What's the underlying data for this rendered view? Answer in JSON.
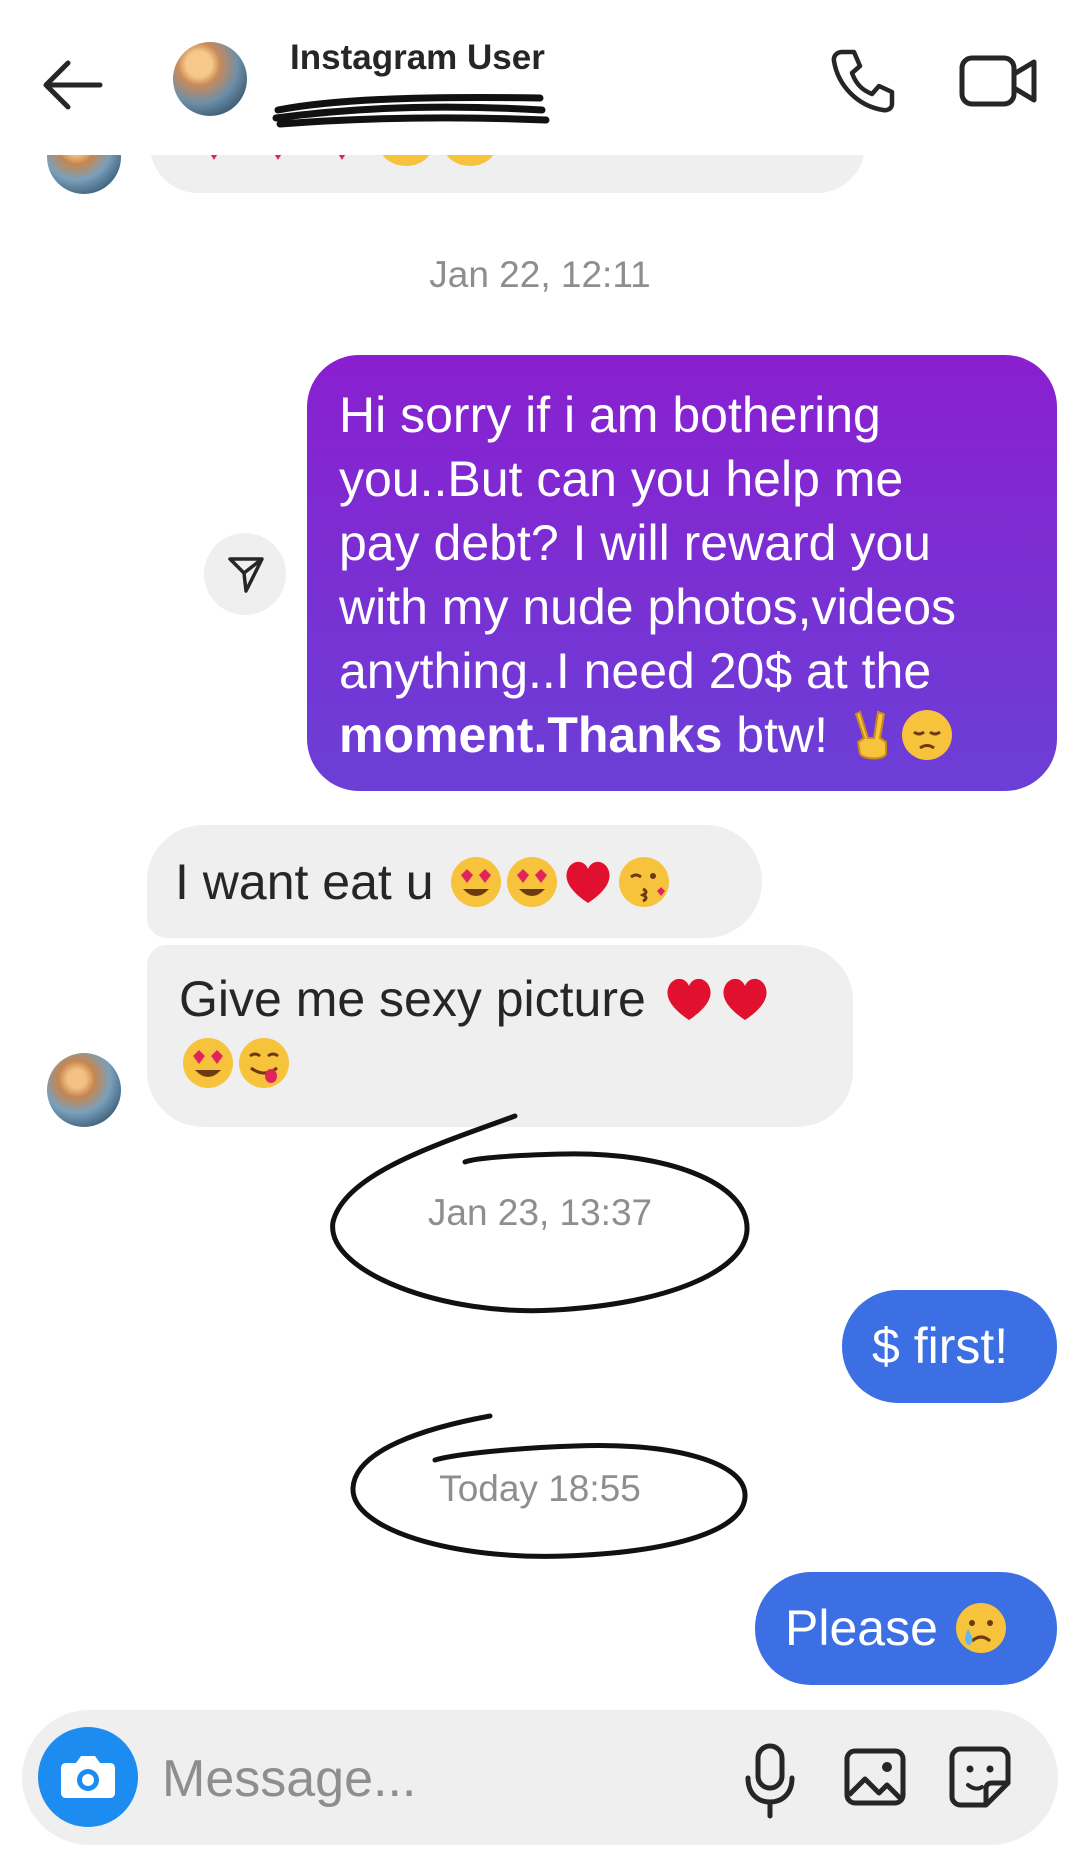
{
  "header": {
    "contact_name": "Instagram User"
  },
  "icons": {
    "back": "arrow-left-icon",
    "phone": "phone-icon",
    "video": "video-camera-icon",
    "send_status": "paper-plane-icon",
    "camera": "camera-icon",
    "mic": "microphone-icon",
    "gallery": "image-icon",
    "sticker": "sticker-icon"
  },
  "timestamps": {
    "t1": "Jan 22, 12:11",
    "t2": "Jan 23, 13:37",
    "t3": "Today 18:55"
  },
  "messages": {
    "sent_long": {
      "line1": "Hi sorry if i am bothering",
      "line2": "you..But can you help me",
      "line3": "pay debt? I will reward you",
      "line4": "with my nude photos,videos",
      "line5": "anything..I need 20$ at the",
      "line6_bold": "moment.Thanks",
      "line6_rest": " btw! "
    },
    "recv1": "I want eat u ",
    "recv2": "Give me sexy picture ",
    "sent_first": "$ first!",
    "sent_please": "Please "
  },
  "composer": {
    "placeholder": "Message..."
  },
  "colors": {
    "sent_gradient_top": "#8a1fd0",
    "sent_gradient_bottom": "#6b3fd6",
    "sent_blue": "#3b6fe3",
    "received_bg": "#efefef",
    "camera_blue": "#1d8cf0"
  }
}
